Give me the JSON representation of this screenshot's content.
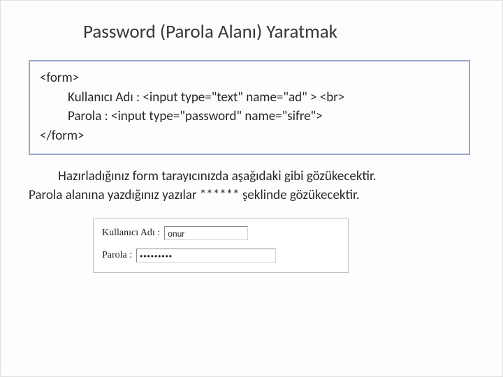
{
  "title": "Password (Parola Alanı) Yaratmak",
  "code": {
    "open": "<form>",
    "line1": "Kullanıcı Adı : <input type=\"text\" name=\"ad\" > <br>",
    "line2": "Parola : <input type=\"password\" name=\"sifre\">",
    "close": "</form>"
  },
  "paragraph": {
    "l1": "Hazırladığınız form tarayıcınızda aşağıdaki gibi gözükecektir.",
    "l2": "Parola alanına yazdığınız yazılar  ****** şeklinde gözükecektir."
  },
  "demo": {
    "userLabel": "Kullanıcı Adı :",
    "userValue": "onur",
    "passLabel": "Parola :",
    "passValue": "•••••••••"
  }
}
